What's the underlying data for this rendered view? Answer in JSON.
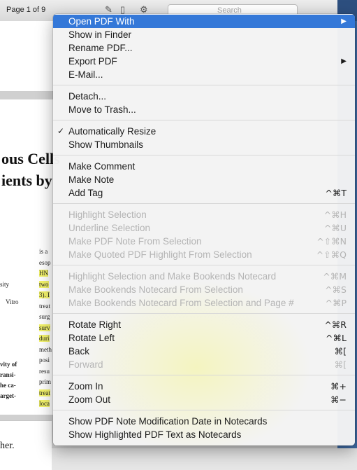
{
  "toolbar": {
    "page_indicator": "Page 1 of 9",
    "search_placeholder": "Search"
  },
  "background_doc": {
    "title_line1": "ous Cells",
    "title_line2": "ients by",
    "col_lines": [
      "is a",
      "esop",
      "HN",
      "two",
      "3). I",
      "treat",
      "surg",
      "surv",
      "duri",
      "meth",
      "posi",
      "resu",
      "prim",
      "treat",
      "loca"
    ],
    "left_notes": [
      "sity",
      "Vitro"
    ],
    "left_bold": [
      "vity of",
      "ransi-",
      "he ca-",
      "arget-"
    ],
    "bottom_text": "her."
  },
  "menu": {
    "groups": [
      [
        {
          "label": "Open PDF With",
          "submenu": true,
          "highlighted": true
        },
        {
          "label": "Show in Finder"
        },
        {
          "label": "Rename PDF..."
        },
        {
          "label": "Export PDF",
          "submenu": true
        },
        {
          "label": "E-Mail..."
        }
      ],
      [
        {
          "label": "Detach..."
        },
        {
          "label": "Move to Trash..."
        }
      ],
      [
        {
          "label": "Automatically Resize",
          "checked": true
        },
        {
          "label": "Show Thumbnails"
        }
      ],
      [
        {
          "label": "Make Comment"
        },
        {
          "label": "Make Note"
        },
        {
          "label": "Add Tag",
          "shortcut": "^⌘T"
        }
      ],
      [
        {
          "label": "Highlight Selection",
          "shortcut": "^⌘H",
          "disabled": true
        },
        {
          "label": "Underline Selection",
          "shortcut": "^⌘U",
          "disabled": true
        },
        {
          "label": "Make PDF Note From Selection",
          "shortcut": "^⇧⌘N",
          "disabled": true
        },
        {
          "label": "Make Quoted PDF Highlight From Selection",
          "shortcut": "^⇧⌘Q",
          "disabled": true
        }
      ],
      [
        {
          "label": "Highlight Selection and Make Bookends Notecard",
          "shortcut": "^⌘M",
          "disabled": true
        },
        {
          "label": "Make Bookends Notecard From Selection",
          "shortcut": "^⌘S",
          "disabled": true
        },
        {
          "label": "Make Bookends Notecard From Selection and Page #",
          "shortcut": "^⌘P",
          "disabled": true
        }
      ],
      [
        {
          "label": "Rotate Right",
          "shortcut": "^⌘R"
        },
        {
          "label": "Rotate Left",
          "shortcut": "^⌘L"
        },
        {
          "label": "Back",
          "shortcut": "⌘["
        },
        {
          "label": "Forward",
          "shortcut": "⌘[",
          "disabled": true
        }
      ],
      [
        {
          "label": "Zoom In",
          "shortcut": "⌘+"
        },
        {
          "label": "Zoom Out",
          "shortcut": "⌘−"
        }
      ],
      [
        {
          "label": "Show PDF Note Modification Date in Notecards"
        },
        {
          "label": "Show Highlighted PDF Text as Notecards"
        }
      ]
    ],
    "colors": {
      "highlight": "#3478d8",
      "disabled_text": "#b4b4b4",
      "doc_highlight": "#f3f36a"
    }
  }
}
